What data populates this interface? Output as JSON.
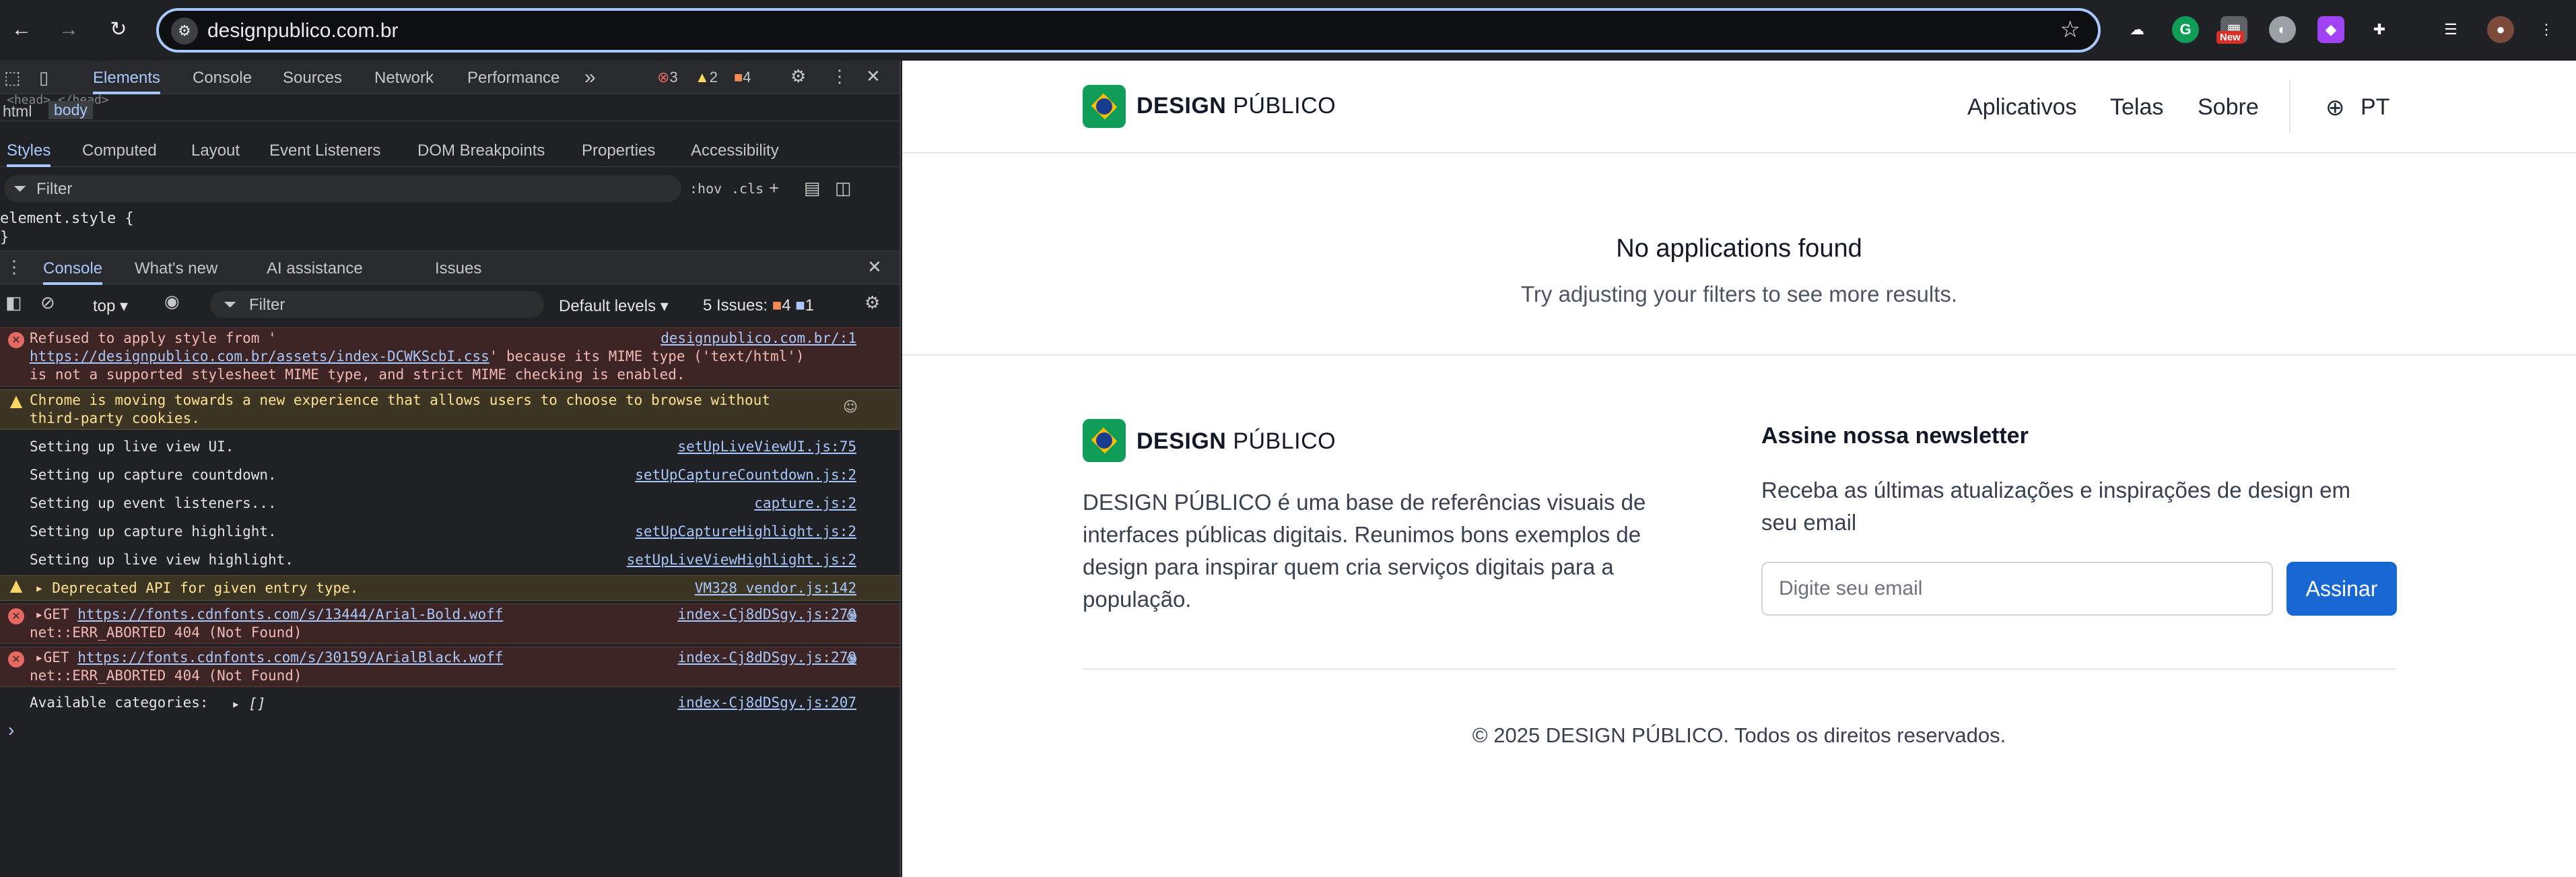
{
  "browser": {
    "url": "designpublico.com.br",
    "ext_badge": "New",
    "accent": "#a8c7fa"
  },
  "devtools": {
    "tabs": [
      "Elements",
      "Console",
      "Sources",
      "Network",
      "Performance"
    ],
    "more": "»",
    "errors": "3",
    "warnings": "2",
    "issues": "4",
    "crumbs": [
      "html",
      "body"
    ],
    "crumb_hidden": "<head>…</head>",
    "styles_tabs": [
      "Styles",
      "Computed",
      "Layout",
      "Event Listeners",
      "DOM Breakpoints",
      "Properties",
      "Accessibility"
    ],
    "filter_placeholder": "Filter",
    "hov": ":hov",
    "cls": ".cls",
    "element_style": "element.style {",
    "element_style_close": "}",
    "drawer_tabs": [
      "Console",
      "What's new",
      "AI assistance",
      "Issues"
    ],
    "context": "top",
    "console_filter": "Filter",
    "levels": "Default levels",
    "issues_label": "5 Issues:",
    "issues_a": "4",
    "issues_b": "1",
    "messages": [
      {
        "type": "error",
        "l1": "Refused to apply style from '",
        "l2_link": "https://designpublico.com.br/assets/index-DCWKScbI.css",
        "l2_rest": "' because its MIME type ('text/html')",
        "l3": "is not a supported stylesheet MIME type, and strict MIME checking is enabled.",
        "src": "designpublico.com.br/:1"
      },
      {
        "type": "warn",
        "l1": "Chrome is moving towards a new experience that allows users to choose to browse without",
        "l2": "third-party cookies."
      },
      {
        "type": "log",
        "text": "Setting up live view UI.",
        "src": "setUpLiveViewUI.js:75"
      },
      {
        "type": "log",
        "text": "Setting up capture countdown.",
        "src": "setUpCaptureCountdown.js:2"
      },
      {
        "type": "log",
        "text": "Setting up event listeners...",
        "src": "capture.js:2"
      },
      {
        "type": "log",
        "text": "Setting up capture highlight.",
        "src": "setUpCaptureHighlight.js:2"
      },
      {
        "type": "log",
        "text": "Setting up live view highlight.",
        "src": "setUpLiveViewHighlight.js:2"
      },
      {
        "type": "warn",
        "text": "Deprecated API for given entry type.",
        "src": "VM328 vendor.js:142"
      },
      {
        "type": "error",
        "l1_pre": "GET ",
        "l1_link": "https://fonts.cdnfonts.com/s/13444/Arial-Bold.woff",
        "l2": "net::ERR_ABORTED 404 (Not Found)",
        "src": "index-Cj8dDSgy.js:279"
      },
      {
        "type": "error",
        "l1_pre": "GET ",
        "l1_link": "https://fonts.cdnfonts.com/s/30159/ArialBlack.woff",
        "l2": "net::ERR_ABORTED 404 (Not Found)",
        "src": "index-Cj8dDSgy.js:279"
      },
      {
        "type": "log",
        "text": "Available categories:",
        "extra": "▸ []",
        "src": "index-Cj8dDSgy.js:207"
      }
    ],
    "prompt": "›"
  },
  "site": {
    "logo_bold": "DESIGN",
    "logo_light": "PÚBLICO",
    "nav": [
      "Aplicativos",
      "Telas",
      "Sobre"
    ],
    "lang": "PT",
    "empty_title": "No applications found",
    "empty_sub": "Try adjusting your filters to see more results.",
    "about": [
      "DESIGN PÚBLICO é uma base de referências visuais de",
      "interfaces públicas digitais. Reunimos bons exemplos de",
      "design para inspirar quem cria serviços digitais para a",
      "população."
    ],
    "newsletter_title": "Assine nossa newsletter",
    "newsletter_text": [
      "Receba as últimas atualizações e inspirações de design em",
      "seu email"
    ],
    "email_placeholder": "Digite seu email",
    "subscribe": "Assinar",
    "copyright": "© 2025 DESIGN PÚBLICO. Todos os direitos reservados.",
    "brand_color": "#1967d2"
  }
}
